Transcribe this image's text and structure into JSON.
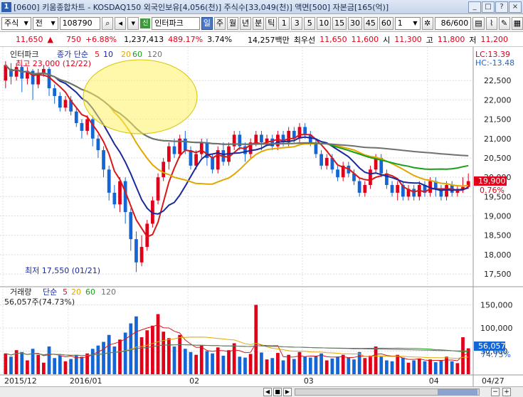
{
  "window": {
    "icon_label": "1",
    "title": "[0600] 키움종합차트 - KOSDAQ150 외국인보유[4,056(천)] 주식수[33,049(천)] 액면[500] 자본금[165(억)]",
    "buttons": [
      "_",
      "□",
      "×",
      "?"
    ]
  },
  "toolbar": {
    "market": "주식",
    "mode": "전",
    "code": "108790",
    "name": "인터파크",
    "periods": [
      "일",
      "주",
      "월",
      "년",
      "분",
      "틱"
    ],
    "selected_period": "일",
    "minutes": [
      "1",
      "3",
      "5",
      "10",
      "15",
      "30",
      "45",
      "60"
    ],
    "minute_value": "1",
    "count": "86/600"
  },
  "quote": {
    "price": "11,650",
    "change": "750",
    "change_pct": "+6.88%",
    "volume": "1,237,413",
    "vol_ratio": "489.17%",
    "turnover": "3.74%",
    "amount": "14,257백만",
    "best_label": "최우선",
    "best_ask": "11,650",
    "best_bid": "11,600",
    "open_label": "시",
    "open": "11,300",
    "high_label": "고",
    "high": "11,800",
    "low_label": "저",
    "low": "11,200"
  },
  "price_panel": {
    "legend_name": "인터파크",
    "legend_ma_label": "종가 단순",
    "ma_periods": [
      "5",
      "10",
      "20",
      "60",
      "120"
    ],
    "ma_colors": [
      "#d81818",
      "#1a2a9a",
      "#e0a800",
      "#18a018",
      "#707070"
    ],
    "max_label": "최고 23,000 (12/22)",
    "min_label": "최저 17,550 (01/21)",
    "lc": "LC:13.39",
    "hc": "HC:-13.48",
    "current_price": "19,900",
    "current_pct": "0.76%",
    "y_ticks": [
      "22,500",
      "22,000",
      "21,500",
      "21,000",
      "20,500",
      "20,000",
      "19,500",
      "19,000",
      "18,500",
      "18,000",
      "17,500"
    ],
    "up_color": "#e0001a",
    "down_color": "#1466d6"
  },
  "volume_panel": {
    "legend_name": "거래량",
    "legend_ma_label": "단순",
    "ma_periods": [
      "5",
      "20",
      "60",
      "120"
    ],
    "ma_colors": [
      "#d81818",
      "#e0a800",
      "#18a018",
      "#707070"
    ],
    "current_label": "56,057주(74.73%)",
    "current_value": "56,057",
    "current_pct": "74.73%",
    "y_ticks": [
      "150,000",
      "100,000",
      "50,000"
    ]
  },
  "x_axis": {
    "labels": [
      "2015/12",
      "2016/01",
      "02",
      "03",
      "04"
    ],
    "last_label": "04/27"
  },
  "chart_data": {
    "type": "candlestick",
    "price_range": [
      17300,
      23000
    ],
    "volume_range": [
      0,
      160000
    ],
    "candles": [
      {
        "o": 22500,
        "c": 22900,
        "h": 23000,
        "l": 22300,
        "v": 45000
      },
      {
        "o": 22800,
        "c": 22600,
        "h": 22950,
        "l": 22400,
        "v": 38000
      },
      {
        "o": 22600,
        "c": 22850,
        "h": 22950,
        "l": 22500,
        "v": 52000
      },
      {
        "o": 22850,
        "c": 22550,
        "h": 22900,
        "l": 22200,
        "v": 48000
      },
      {
        "o": 22550,
        "c": 22750,
        "h": 22850,
        "l": 22400,
        "v": 30000
      },
      {
        "o": 22750,
        "c": 22400,
        "h": 22800,
        "l": 22000,
        "v": 55000
      },
      {
        "o": 22400,
        "c": 22700,
        "h": 22800,
        "l": 22300,
        "v": 42000
      },
      {
        "o": 22700,
        "c": 22800,
        "h": 22900,
        "l": 22600,
        "v": 25000
      },
      {
        "o": 22800,
        "c": 22300,
        "h": 22850,
        "l": 22100,
        "v": 60000
      },
      {
        "o": 22300,
        "c": 22100,
        "h": 22400,
        "l": 21900,
        "v": 35000
      },
      {
        "o": 22100,
        "c": 21800,
        "h": 22200,
        "l": 21700,
        "v": 40000
      },
      {
        "o": 21800,
        "c": 22000,
        "h": 22100,
        "l": 21700,
        "v": 28000
      },
      {
        "o": 22000,
        "c": 21700,
        "h": 22100,
        "l": 21600,
        "v": 33000
      },
      {
        "o": 21700,
        "c": 21400,
        "h": 21800,
        "l": 21300,
        "v": 42000
      },
      {
        "o": 21400,
        "c": 21200,
        "h": 21500,
        "l": 21000,
        "v": 38000
      },
      {
        "o": 21200,
        "c": 21500,
        "h": 21600,
        "l": 21100,
        "v": 45000
      },
      {
        "o": 21500,
        "c": 21000,
        "h": 21600,
        "l": 20800,
        "v": 55000
      },
      {
        "o": 21000,
        "c": 20700,
        "h": 21100,
        "l": 20500,
        "v": 62000
      },
      {
        "o": 20700,
        "c": 20200,
        "h": 20800,
        "l": 20000,
        "v": 70000
      },
      {
        "o": 20200,
        "c": 19600,
        "h": 20300,
        "l": 19400,
        "v": 85000
      },
      {
        "o": 19600,
        "c": 19300,
        "h": 19800,
        "l": 19200,
        "v": 60000
      },
      {
        "o": 19300,
        "c": 19900,
        "h": 20000,
        "l": 19100,
        "v": 75000
      },
      {
        "o": 19900,
        "c": 19100,
        "h": 20000,
        "l": 18800,
        "v": 90000
      },
      {
        "o": 19100,
        "c": 18400,
        "h": 19200,
        "l": 18100,
        "v": 110000
      },
      {
        "o": 18400,
        "c": 17800,
        "h": 18600,
        "l": 17550,
        "v": 125000
      },
      {
        "o": 17800,
        "c": 18200,
        "h": 18500,
        "l": 17700,
        "v": 80000
      },
      {
        "o": 18200,
        "c": 18800,
        "h": 18900,
        "l": 18100,
        "v": 95000
      },
      {
        "o": 18800,
        "c": 19400,
        "h": 19500,
        "l": 18700,
        "v": 105000
      },
      {
        "o": 19400,
        "c": 20000,
        "h": 20100,
        "l": 19300,
        "v": 130000
      },
      {
        "o": 20000,
        "c": 20400,
        "h": 20500,
        "l": 19900,
        "v": 92000
      },
      {
        "o": 20400,
        "c": 20800,
        "h": 20900,
        "l": 20200,
        "v": 78000
      },
      {
        "o": 20800,
        "c": 20600,
        "h": 21000,
        "l": 20500,
        "v": 60000
      },
      {
        "o": 20600,
        "c": 21000,
        "h": 21100,
        "l": 20500,
        "v": 85000
      },
      {
        "o": 21000,
        "c": 20700,
        "h": 21200,
        "l": 20600,
        "v": 55000
      },
      {
        "o": 20700,
        "c": 20300,
        "h": 20800,
        "l": 20200,
        "v": 48000
      },
      {
        "o": 20300,
        "c": 20600,
        "h": 20700,
        "l": 20200,
        "v": 42000
      },
      {
        "o": 20600,
        "c": 20900,
        "h": 21000,
        "l": 20500,
        "v": 62000
      },
      {
        "o": 20900,
        "c": 20500,
        "h": 21000,
        "l": 20300,
        "v": 50000
      },
      {
        "o": 20500,
        "c": 20200,
        "h": 20600,
        "l": 20100,
        "v": 45000
      },
      {
        "o": 20200,
        "c": 20700,
        "h": 20800,
        "l": 20100,
        "v": 58000
      },
      {
        "o": 20700,
        "c": 20400,
        "h": 20900,
        "l": 20300,
        "v": 40000
      },
      {
        "o": 20400,
        "c": 20800,
        "h": 20900,
        "l": 20300,
        "v": 52000
      },
      {
        "o": 20800,
        "c": 21100,
        "h": 21200,
        "l": 20700,
        "v": 67000
      },
      {
        "o": 21100,
        "c": 20800,
        "h": 21200,
        "l": 20700,
        "v": 38000
      },
      {
        "o": 20800,
        "c": 20600,
        "h": 20900,
        "l": 20400,
        "v": 36000
      },
      {
        "o": 20600,
        "c": 20900,
        "h": 21000,
        "l": 20500,
        "v": 44000
      },
      {
        "o": 20900,
        "c": 21100,
        "h": 21200,
        "l": 20800,
        "v": 150000
      },
      {
        "o": 21100,
        "c": 20900,
        "h": 21200,
        "l": 20700,
        "v": 47000
      },
      {
        "o": 20900,
        "c": 21000,
        "h": 21100,
        "l": 20800,
        "v": 32000
      },
      {
        "o": 21000,
        "c": 20800,
        "h": 21100,
        "l": 20700,
        "v": 35000
      },
      {
        "o": 20800,
        "c": 21100,
        "h": 21200,
        "l": 20700,
        "v": 46000
      },
      {
        "o": 21100,
        "c": 20900,
        "h": 21200,
        "l": 20800,
        "v": 30000
      },
      {
        "o": 20900,
        "c": 21200,
        "h": 21300,
        "l": 20800,
        "v": 42000
      },
      {
        "o": 21200,
        "c": 21000,
        "h": 21300,
        "l": 20900,
        "v": 33000
      },
      {
        "o": 21000,
        "c": 21300,
        "h": 21400,
        "l": 20900,
        "v": 48000
      },
      {
        "o": 21300,
        "c": 21100,
        "h": 21400,
        "l": 21000,
        "v": 38000
      },
      {
        "o": 21100,
        "c": 20900,
        "h": 21200,
        "l": 20800,
        "v": 36000
      },
      {
        "o": 20900,
        "c": 20600,
        "h": 21000,
        "l": 20500,
        "v": 40000
      },
      {
        "o": 20600,
        "c": 20300,
        "h": 20700,
        "l": 20200,
        "v": 45000
      },
      {
        "o": 20300,
        "c": 20500,
        "h": 20600,
        "l": 20200,
        "v": 30000
      },
      {
        "o": 20500,
        "c": 20200,
        "h": 20600,
        "l": 20100,
        "v": 34000
      },
      {
        "o": 20200,
        "c": 20000,
        "h": 20300,
        "l": 19900,
        "v": 38000
      },
      {
        "o": 20000,
        "c": 20300,
        "h": 20400,
        "l": 19900,
        "v": 42000
      },
      {
        "o": 20300,
        "c": 20100,
        "h": 20400,
        "l": 20000,
        "v": 36000
      },
      {
        "o": 20100,
        "c": 19900,
        "h": 20200,
        "l": 19800,
        "v": 32000
      },
      {
        "o": 19900,
        "c": 19600,
        "h": 20000,
        "l": 19500,
        "v": 48000
      },
      {
        "o": 19600,
        "c": 19800,
        "h": 19900,
        "l": 19500,
        "v": 35000
      },
      {
        "o": 19800,
        "c": 20200,
        "h": 20300,
        "l": 19700,
        "v": 40000
      },
      {
        "o": 20200,
        "c": 20500,
        "h": 20600,
        "l": 20100,
        "v": 60000
      },
      {
        "o": 20500,
        "c": 20100,
        "h": 20600,
        "l": 20000,
        "v": 38000
      },
      {
        "o": 20100,
        "c": 19800,
        "h": 20200,
        "l": 19700,
        "v": 30000
      },
      {
        "o": 19800,
        "c": 19600,
        "h": 19900,
        "l": 19500,
        "v": 28000
      },
      {
        "o": 19600,
        "c": 19800,
        "h": 19900,
        "l": 19400,
        "v": 42000
      },
      {
        "o": 19800,
        "c": 19500,
        "h": 19900,
        "l": 19400,
        "v": 36000
      },
      {
        "o": 19500,
        "c": 19700,
        "h": 19800,
        "l": 19400,
        "v": 25000
      },
      {
        "o": 19700,
        "c": 19500,
        "h": 19800,
        "l": 19400,
        "v": 30000
      },
      {
        "o": 19500,
        "c": 19800,
        "h": 19900,
        "l": 19400,
        "v": 34000
      },
      {
        "o": 19800,
        "c": 19600,
        "h": 19900,
        "l": 19500,
        "v": 28000
      },
      {
        "o": 19600,
        "c": 19900,
        "h": 20000,
        "l": 19500,
        "v": 32000
      },
      {
        "o": 19900,
        "c": 19700,
        "h": 20000,
        "l": 19500,
        "v": 26000
      },
      {
        "o": 19700,
        "c": 19500,
        "h": 19800,
        "l": 19400,
        "v": 30000
      },
      {
        "o": 19500,
        "c": 19800,
        "h": 19900,
        "l": 19400,
        "v": 38000
      },
      {
        "o": 19800,
        "c": 19600,
        "h": 19900,
        "l": 19500,
        "v": 28000
      },
      {
        "o": 19600,
        "c": 19700,
        "h": 19800,
        "l": 19500,
        "v": 24000
      },
      {
        "o": 19700,
        "c": 19750,
        "h": 20000,
        "l": 19600,
        "v": 80000
      },
      {
        "o": 19750,
        "c": 19900,
        "h": 20100,
        "l": 19700,
        "v": 56057
      }
    ]
  }
}
